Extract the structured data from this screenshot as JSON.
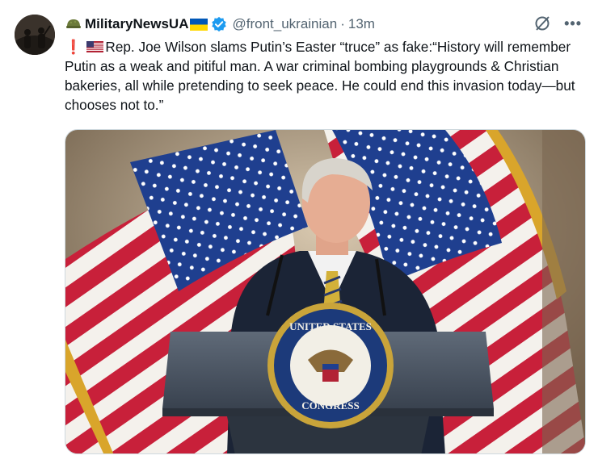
{
  "author": {
    "display_name": "MilitaryNewsUA",
    "handle": "@front_ukrainian",
    "separator": "·",
    "time": "13m",
    "verified": true,
    "avatar_icon": "soldiers-silhouette-avatar",
    "name_icon": "helmet-icon",
    "name_flag": "ukraine-flag"
  },
  "tweet": {
    "exclamation": "❗",
    "flag": "us-flag",
    "body": "Rep. Joe Wilson slams Putin’s Easter “truce” as fake:“History will remember Putin as a weak and pitiful man. A war criminal bombing playgrounds & Christian bakeries, all while pretending to seek peace. He could end this invasion today—but chooses not to.”"
  },
  "media": {
    "seal_top_text": "UNITED STATES",
    "seal_bottom_text": "CONGRESS"
  },
  "colors": {
    "text": "#0f1419",
    "secondary": "#536471",
    "verified_blue": "#1d9bf0",
    "ukraine_blue": "#0057b7",
    "ukraine_yellow": "#ffd700"
  }
}
